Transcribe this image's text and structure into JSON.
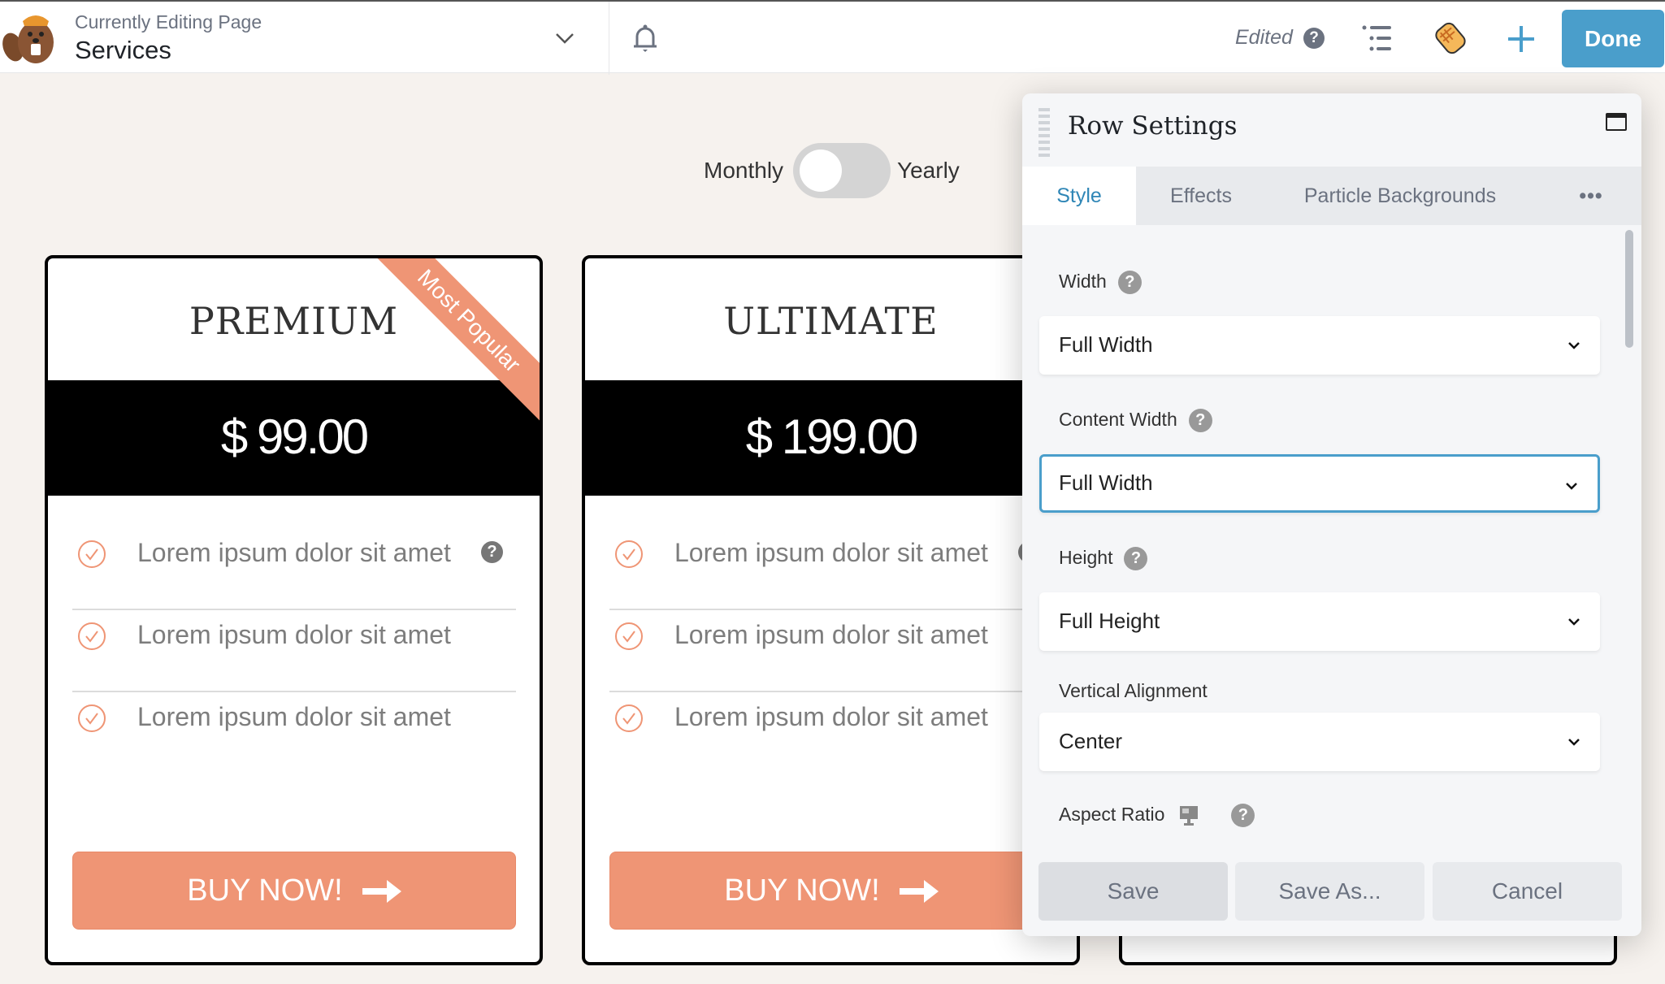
{
  "topbar": {
    "subtitle": "Currently Editing Page",
    "page_title": "Services",
    "status": "Edited",
    "done_label": "Done",
    "icons": [
      "beaver-logo-icon",
      "chevron-down-icon",
      "bell-icon",
      "help-icon",
      "outline-list-icon",
      "tools-pencil-icon",
      "plus-icon"
    ],
    "accent_color": "#4a9ecb"
  },
  "pricing_toggle": {
    "left_label": "Monthly",
    "right_label": "Yearly",
    "selected": "Monthly"
  },
  "cards": [
    {
      "title": "PREMIUM",
      "price": "$ 99.00",
      "ribbon": "Most Popular",
      "features": [
        "Lorem ipsum dolor sit amet",
        "Lorem ipsum dolor sit amet",
        "Lorem ipsum dolor sit amet"
      ],
      "button": "BUY NOW!"
    },
    {
      "title": "ULTIMATE",
      "price": "$ 199.00",
      "features": [
        "Lorem ipsum dolor sit amet",
        "Lorem ipsum dolor sit amet",
        "Lorem ipsum dolor sit amet"
      ],
      "button": "BUY NOW!"
    }
  ],
  "colors": {
    "button": "#ef9575",
    "page_bg": "#f6f2ee",
    "active_tab": "#2f86b6"
  },
  "panel": {
    "title": "Row Settings",
    "tabs": [
      "Style",
      "Effects",
      "Particle Backgrounds",
      "•••"
    ],
    "active_tab": "Style",
    "fields": {
      "width": {
        "label": "Width",
        "value": "Full Width"
      },
      "content_width": {
        "label": "Content Width",
        "value": "Full Width"
      },
      "height": {
        "label": "Height",
        "value": "Full Height"
      },
      "vertical_alignment": {
        "label": "Vertical Alignment",
        "value": "Center"
      },
      "aspect_ratio": {
        "label": "Aspect Ratio"
      }
    },
    "buttons": {
      "save": "Save",
      "save_as": "Save As...",
      "cancel": "Cancel"
    },
    "help_glyph": "?"
  }
}
